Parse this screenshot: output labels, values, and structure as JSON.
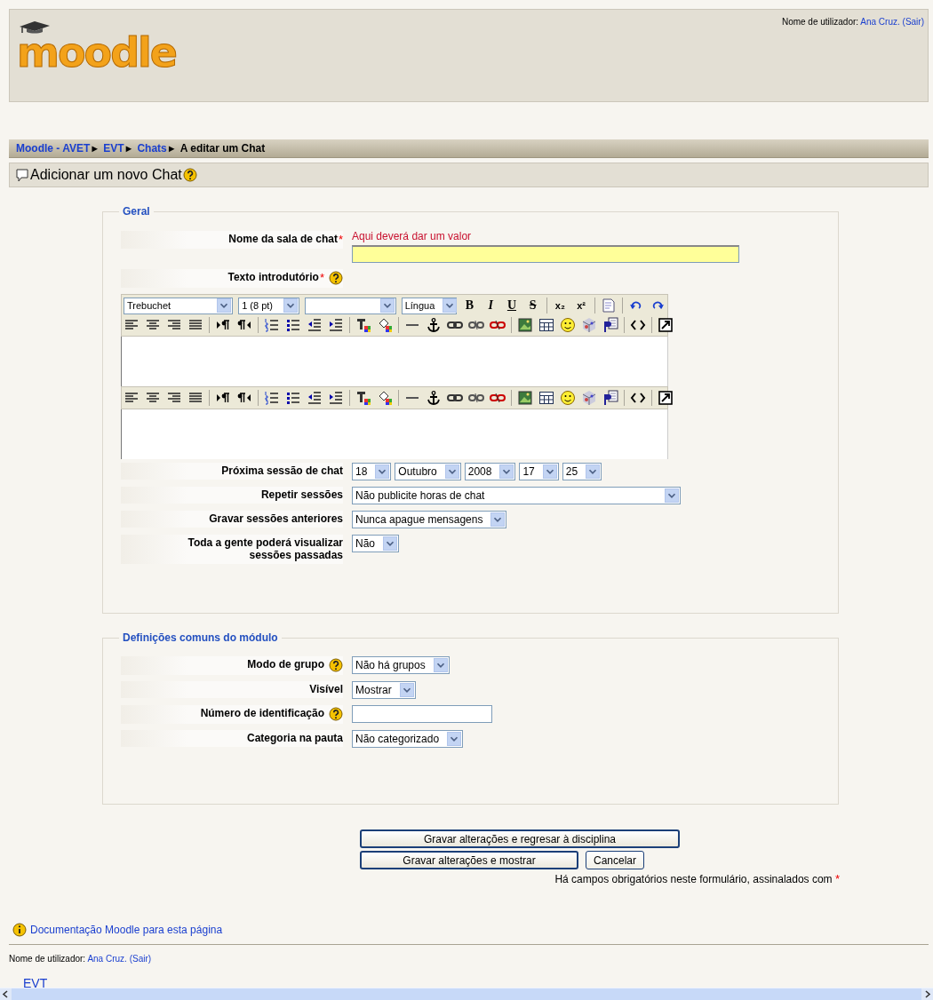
{
  "header": {
    "logo": "moodle",
    "login": {
      "label": "Nome de utilizador:",
      "user": "Ana Cruz.",
      "logout": "(Sair)"
    }
  },
  "breadcrumb": {
    "separator": "►",
    "items": [
      {
        "text": "Moodle - AVET",
        "link": true
      },
      {
        "text": "EVT",
        "link": true
      },
      {
        "text": "Chats",
        "link": true
      },
      {
        "text": "A editar um Chat",
        "link": false
      }
    ]
  },
  "heading": {
    "title": "Adicionar um novo Chat",
    "help": true
  },
  "form": {
    "required_mark": "*",
    "sections": [
      {
        "legend": "Geral",
        "rows": [
          {
            "kind": "text",
            "label": "Nome da sala de chat",
            "required": true,
            "help": false,
            "error": "Aqui deverá dar um valor"
          },
          {
            "kind": "editor",
            "label": "Texto introdutório",
            "required": true,
            "help": true,
            "editor": {
              "dropdowns": [
                {
                  "kind": "value",
                  "value": "Trebuchet"
                },
                {
                  "kind": "value",
                  "value": "1 (8 pt)"
                },
                {
                  "kind": "blank"
                },
                {
                  "kind": "value",
                  "value": "Língua"
                }
              ],
              "text_buttons": [
                {
                  "text": "B",
                  "kind": "bold"
                },
                {
                  "text": "I",
                  "kind": "italic"
                },
                {
                  "text": "U",
                  "kind": "underline"
                },
                {
                  "text": "S",
                  "kind": "strike"
                },
                {
                  "text": "x₂",
                  "kind": "sub"
                },
                {
                  "text": "x²",
                  "kind": "sup"
                }
              ]
            }
          },
          {
            "kind": "selects",
            "label": "Próxima sessão de chat",
            "required": false,
            "help": false,
            "values": [
              "18",
              "Outubro",
              "2008",
              "17",
              "25"
            ]
          },
          {
            "kind": "wide_select",
            "label": "Repetir sessões",
            "required": false,
            "help": false,
            "values": [
              "Não publicite horas de chat"
            ]
          },
          {
            "kind": "selects",
            "label": "Gravar sessões anteriores",
            "required": false,
            "help": false,
            "values": [
              "Nunca apague mensagens"
            ]
          },
          {
            "kind": "selects",
            "label": "Toda a gente poderá visualizar sessões passadas",
            "required": false,
            "help": false,
            "values": [
              "Não"
            ]
          }
        ]
      },
      {
        "legend": "Definições comuns do módulo",
        "rows": [
          {
            "kind": "selects",
            "label": "Modo de grupo",
            "required": false,
            "help": true,
            "values": [
              "Não há grupos"
            ]
          },
          {
            "kind": "selects",
            "label": "Visível",
            "required": false,
            "help": false,
            "values": [
              "Mostrar"
            ]
          },
          {
            "kind": "text",
            "label": "Número de identificação",
            "required": false,
            "help": true
          },
          {
            "kind": "selects",
            "label": "Categoria na pauta",
            "required": false,
            "help": false,
            "values": [
              "Não categorizado"
            ]
          }
        ]
      }
    ]
  },
  "actions": {
    "buttons": [
      {
        "text": "Gravar alterações e regresar à disciplina",
        "kind": "default"
      },
      {
        "text": "Gravar alterações e mostrar",
        "kind": "default"
      },
      {
        "text": "Cancelar",
        "kind": "plain"
      }
    ],
    "note": "Há campos obrigatórios neste formulário, assinalados com"
  },
  "footer": {
    "doc_link": "Documentação Moodle para esta página",
    "login": {
      "label": "Nome de utilizador:",
      "user": "Ana Cruz.",
      "logout": "(Sair)"
    },
    "course_link": "EVT"
  }
}
